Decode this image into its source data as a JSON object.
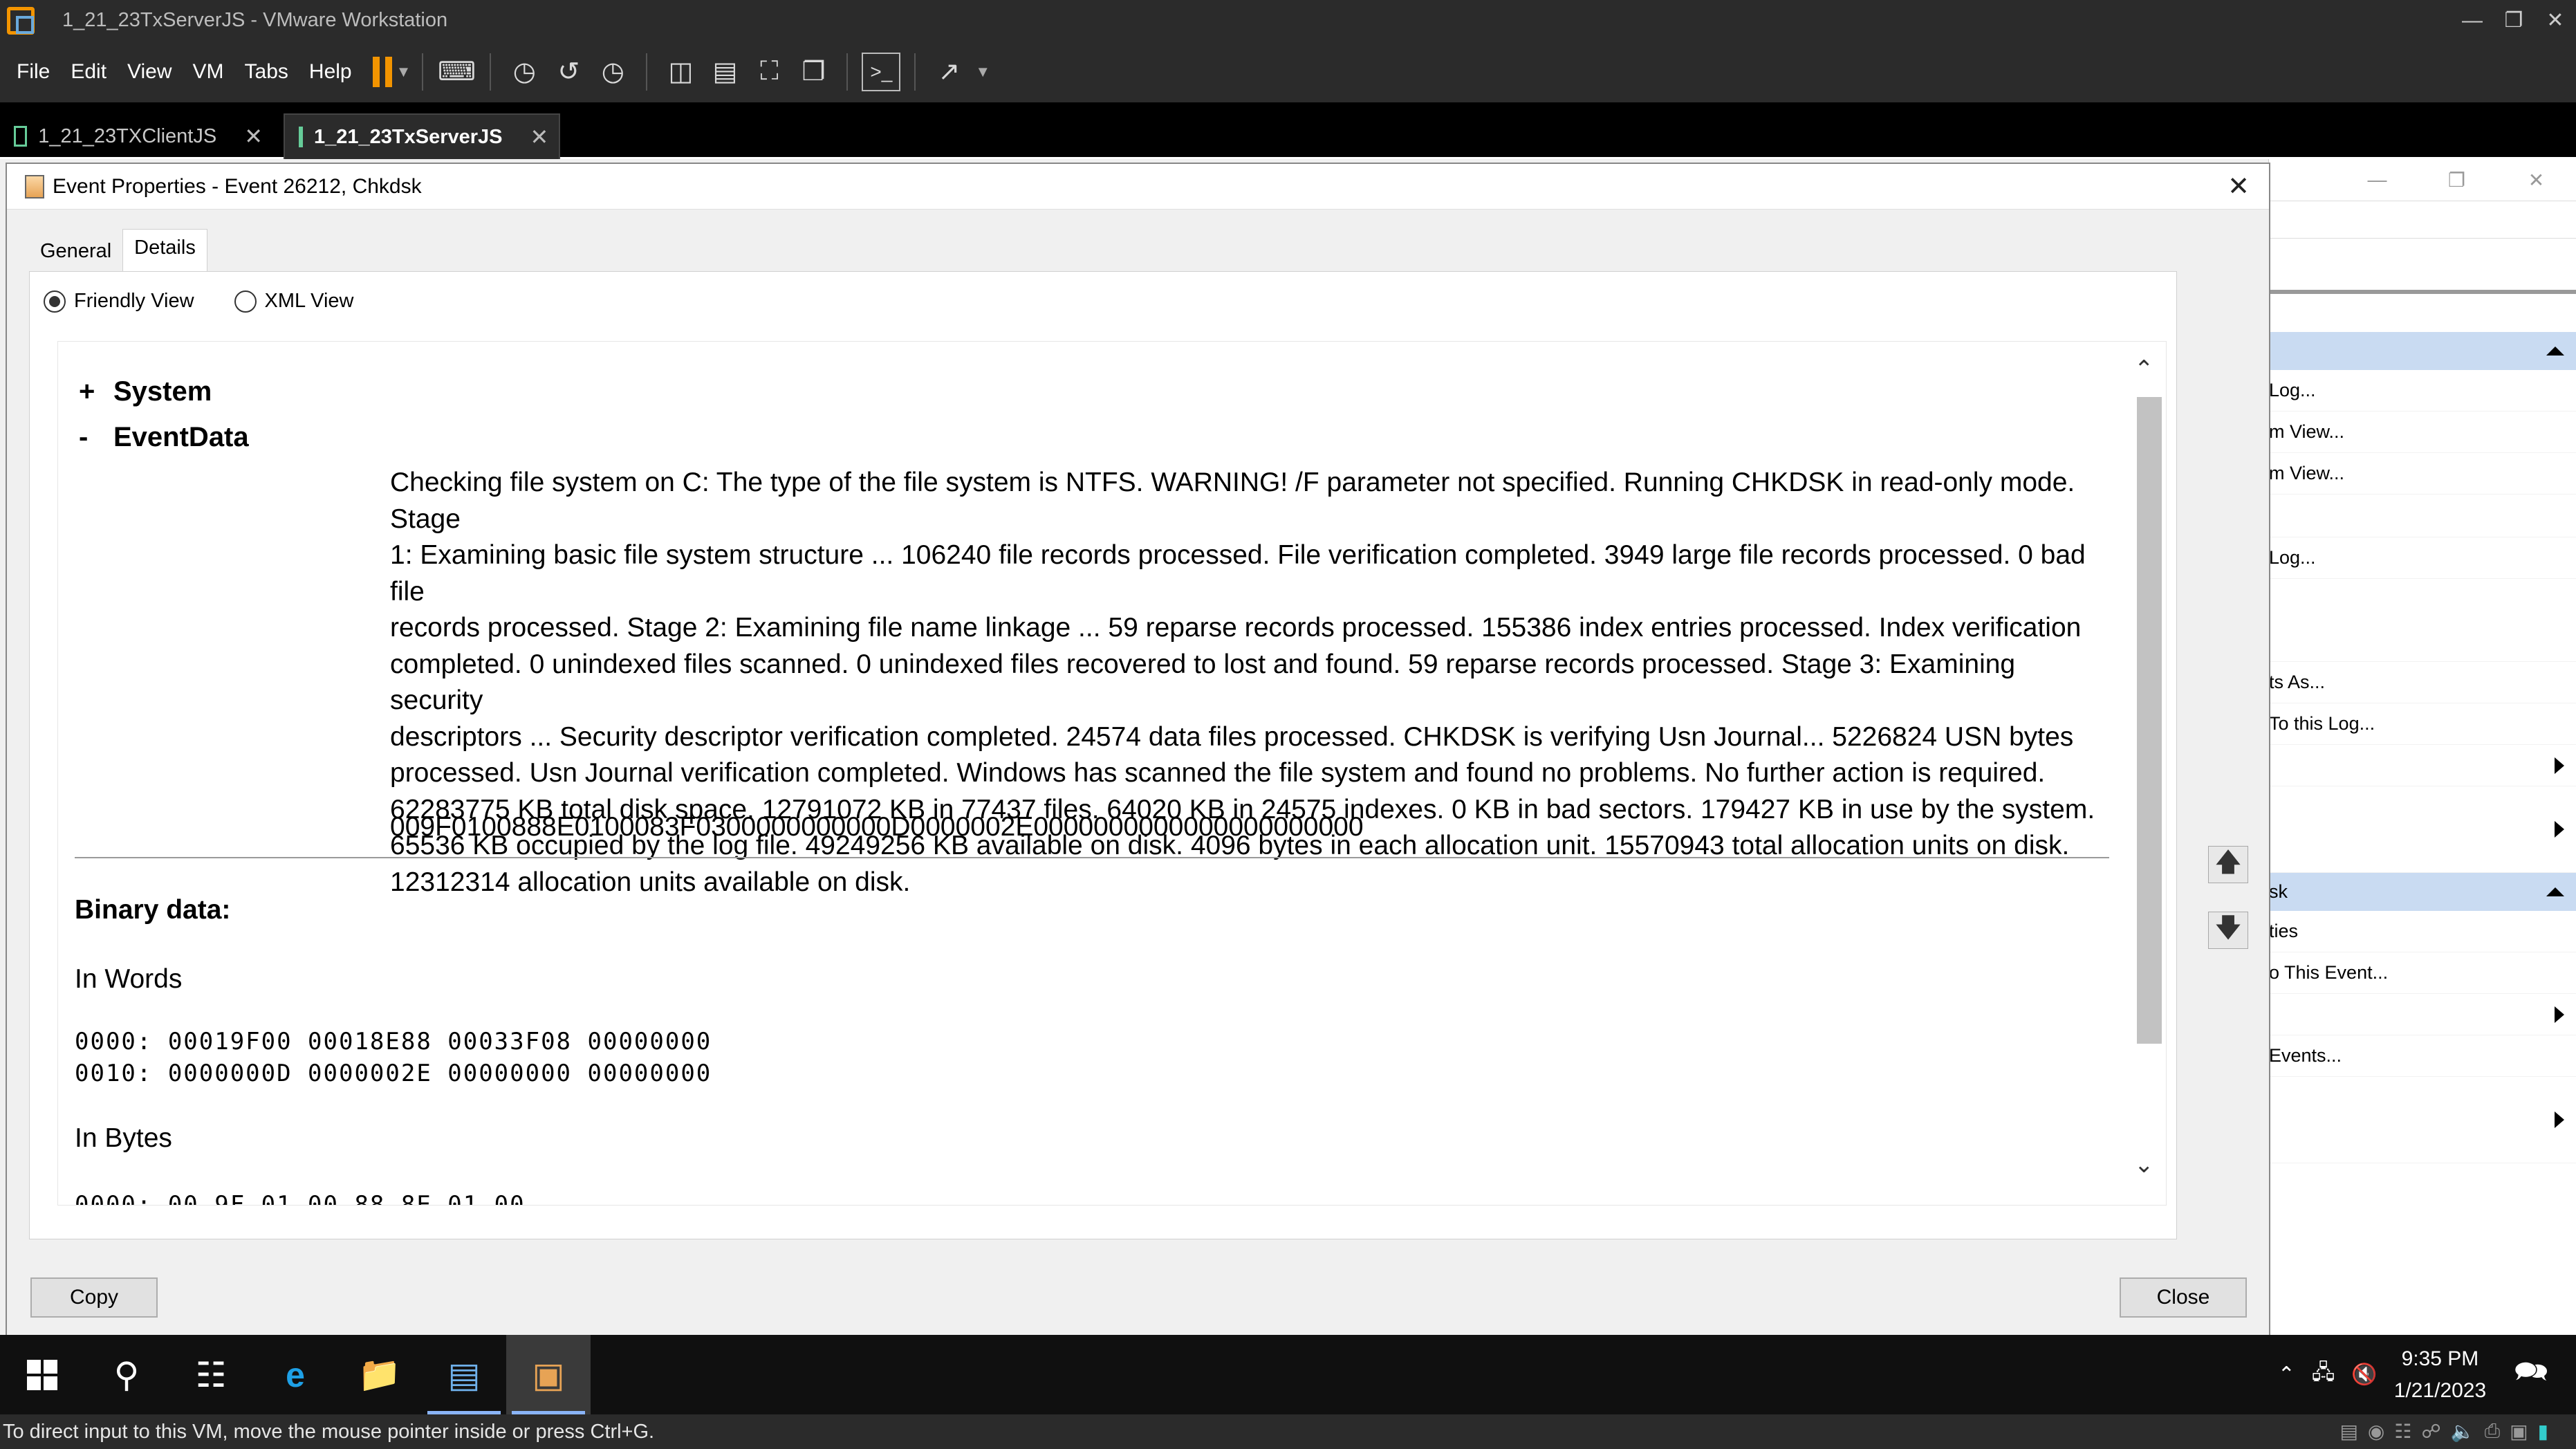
{
  "vmware": {
    "window_title": "1_21_23TxServerJS - VMware Workstation",
    "menu": [
      "File",
      "Edit",
      "View",
      "VM",
      "Tabs",
      "Help"
    ],
    "tabs": [
      {
        "label": "1_21_23TXClientJS",
        "active": false
      },
      {
        "label": "1_21_23TxServerJS",
        "active": true
      }
    ],
    "status_text": "To direct input to this VM, move the mouse pointer inside or press Ctrl+G."
  },
  "background_window": {
    "actions": [
      {
        "label": "Log...",
        "kind": "item"
      },
      {
        "label": "m View...",
        "kind": "item"
      },
      {
        "label": "m View...",
        "kind": "item"
      },
      {
        "label": "Log...",
        "kind": "item"
      },
      {
        "label": "ts As...",
        "kind": "item"
      },
      {
        "label": "To this Log...",
        "kind": "item"
      },
      {
        "label": "sk",
        "kind": "header"
      },
      {
        "label": "ties",
        "kind": "item"
      },
      {
        "label": "o This Event...",
        "kind": "item"
      },
      {
        "label": "Events...",
        "kind": "item"
      }
    ]
  },
  "dialog": {
    "title": "Event Properties - Event 26212, Chkdsk",
    "tabs": [
      {
        "label": "General",
        "active": false
      },
      {
        "label": "Details",
        "active": true
      }
    ],
    "view_options": [
      {
        "label": "Friendly View",
        "checked": true
      },
      {
        "label": "XML View",
        "checked": false
      }
    ],
    "system_label": "System",
    "system_sign": "+",
    "eventdata_label": "EventData",
    "eventdata_sign": "-",
    "event_lines": [
      "Checking file system on C: The type of the file system is NTFS. WARNING! /F parameter not specified. Running CHKDSK in read-only mode. Stage",
      "1: Examining basic file system structure ... 106240 file records processed. File verification completed. 3949 large file records processed. 0 bad file",
      "records processed. Stage 2: Examining file name linkage ... 59 reparse records processed. 155386 index entries processed. Index verification",
      "completed. 0 unindexed files scanned. 0 unindexed files recovered to lost and found. 59 reparse records processed. Stage 3: Examining security",
      "descriptors ... Security descriptor verification completed. 24574 data files processed. CHKDSK is verifying Usn Journal... 5226824 USN bytes",
      "processed. Usn Journal verification completed. Windows has scanned the file system and found no problems. No further action is required.",
      "62283775 KB total disk space. 12791072 KB in 77437 files. 64020 KB in 24575 indexes. 0 KB in bad sectors. 179427 KB in use by the system.",
      "65536 KB occupied by the log file. 49249256 KB available on disk. 4096 bytes in each allocation unit. 15570943 total allocation units on disk.",
      "12312314 allocation units available on disk."
    ],
    "hex_data": "009F0100888E0100083F0300000000000D0000002E0000000000000000000000",
    "binary_title": "Binary data:",
    "in_words_title": "In Words",
    "words_lines": [
      "0000: 00019F00 00018E88 00033F08 00000000",
      "0010: 0000000D 0000002E 00000000 00000000"
    ],
    "in_bytes_title": "In Bytes",
    "bytes_partial": "0000: 00 9F 01 00 88 8E 01 00",
    "copy_label": "Copy",
    "close_label": "Close"
  },
  "taskbar": {
    "time": "9:35 PM",
    "date": "1/21/2023"
  }
}
